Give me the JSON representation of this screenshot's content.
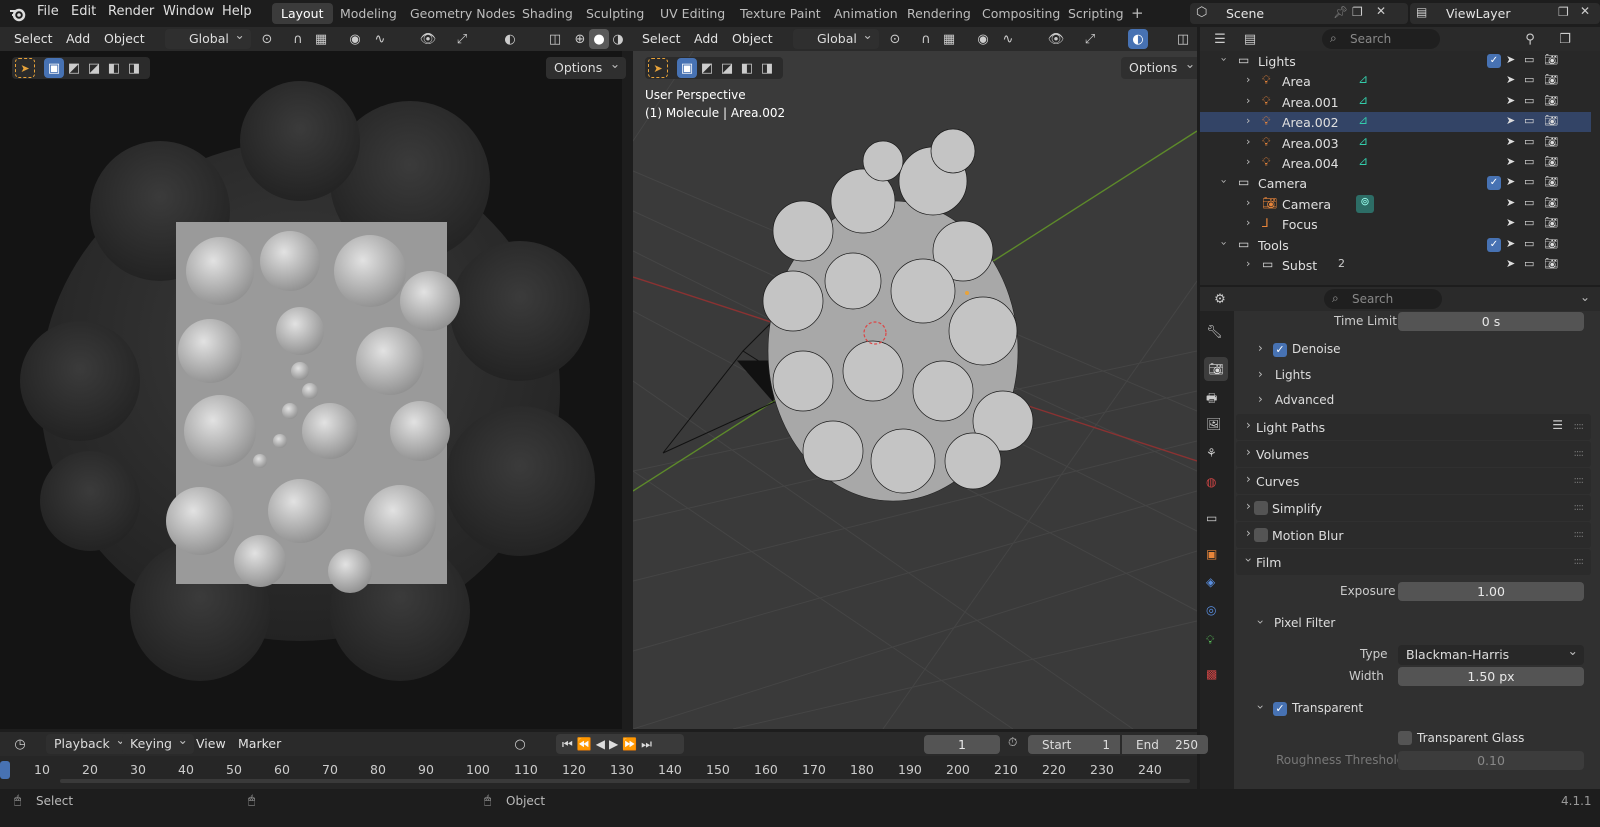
{
  "menu": {
    "file": "File",
    "edit": "Edit",
    "render": "Render",
    "window": "Window",
    "help": "Help"
  },
  "workspaces": [
    "Layout",
    "Modeling",
    "Geometry Nodes",
    "Shading",
    "Sculpting",
    "UV Editing",
    "Texture Paint",
    "Animation",
    "Rendering",
    "Compositing",
    "Scripting"
  ],
  "scene": {
    "name": "Scene",
    "view_layer": "ViewLayer"
  },
  "left_view": {
    "select": "Select",
    "add": "Add",
    "object": "Object",
    "orientation": "Global",
    "options": "Options"
  },
  "right_view": {
    "select": "Select",
    "add": "Add",
    "object": "Object",
    "orientation": "Global",
    "options": "Options",
    "perspective": "User Perspective",
    "context": "(1) Molecule | Area.002"
  },
  "outliner": {
    "search_placeholder": "Search",
    "items": [
      {
        "label": "Lights",
        "level": 0,
        "type": "collection"
      },
      {
        "label": "Area",
        "level": 1,
        "type": "light"
      },
      {
        "label": "Area.001",
        "level": 1,
        "type": "light"
      },
      {
        "label": "Area.002",
        "level": 1,
        "type": "light"
      },
      {
        "label": "Area.003",
        "level": 1,
        "type": "light"
      },
      {
        "label": "Area.004",
        "level": 1,
        "type": "light"
      },
      {
        "label": "Camera",
        "level": 0,
        "type": "collection"
      },
      {
        "label": "Camera",
        "level": 1,
        "type": "camera"
      },
      {
        "label": "Focus",
        "level": 1,
        "type": "empty"
      },
      {
        "label": "Tools",
        "level": 0,
        "type": "collection"
      },
      {
        "label": "Subst",
        "level": 1,
        "type": "collection",
        "badge": "2"
      }
    ]
  },
  "properties": {
    "search_placeholder": "Search",
    "time_limit_label": "Time Limit",
    "time_limit_value": "0 s",
    "denoise": "Denoise",
    "lights": "Lights",
    "advanced": "Advanced",
    "light_paths": "Light Paths",
    "volumes": "Volumes",
    "curves": "Curves",
    "simplify": "Simplify",
    "motion_blur": "Motion Blur",
    "film": "Film",
    "exposure_label": "Exposure",
    "exposure_value": "1.00",
    "pixel_filter": "Pixel Filter",
    "type_label": "Type",
    "type_value": "Blackman-Harris",
    "width_label": "Width",
    "width_value": "1.50 px",
    "transparent": "Transparent",
    "transparent_glass": "Transparent Glass",
    "roughness_label": "Roughness Threshold",
    "roughness_value": "0.10"
  },
  "timeline": {
    "playback": "Playback",
    "keying": "Keying",
    "view": "View",
    "marker": "Marker",
    "current": "1",
    "start_label": "Start",
    "start_value": "1",
    "end_label": "End",
    "end_value": "250",
    "ticks": [
      "10",
      "20",
      "30",
      "40",
      "50",
      "60",
      "70",
      "80",
      "90",
      "100",
      "110",
      "120",
      "130",
      "140",
      "150",
      "160",
      "170",
      "180",
      "190",
      "200",
      "210",
      "220",
      "230",
      "240"
    ]
  },
  "status": {
    "select": "Select",
    "object": "Object",
    "version": "4.1.1"
  },
  "colors": {
    "accent": "#4772b3",
    "panel": "#2b2b2b",
    "viewport": "#3a3a3a"
  }
}
